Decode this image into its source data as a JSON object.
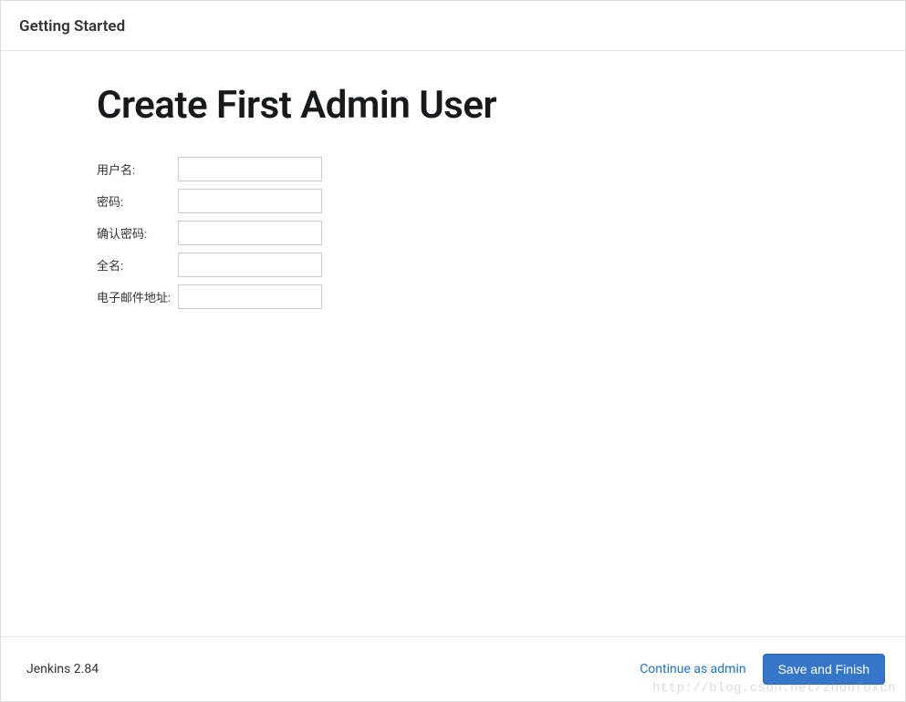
{
  "header": {
    "title": "Getting Started"
  },
  "main": {
    "title": "Create First Admin User",
    "form": {
      "username_label": "用户名:",
      "password_label": "密码:",
      "confirm_password_label": "确认密码:",
      "fullname_label": "全名:",
      "email_label": "电子邮件地址:",
      "username_value": "",
      "password_value": "",
      "confirm_password_value": "",
      "fullname_value": "",
      "email_value": ""
    }
  },
  "footer": {
    "version": "Jenkins 2.84",
    "continue_label": "Continue as admin",
    "save_label": "Save and Finish"
  },
  "watermark": "http://blog.csdn.net/zhoufoxcn"
}
